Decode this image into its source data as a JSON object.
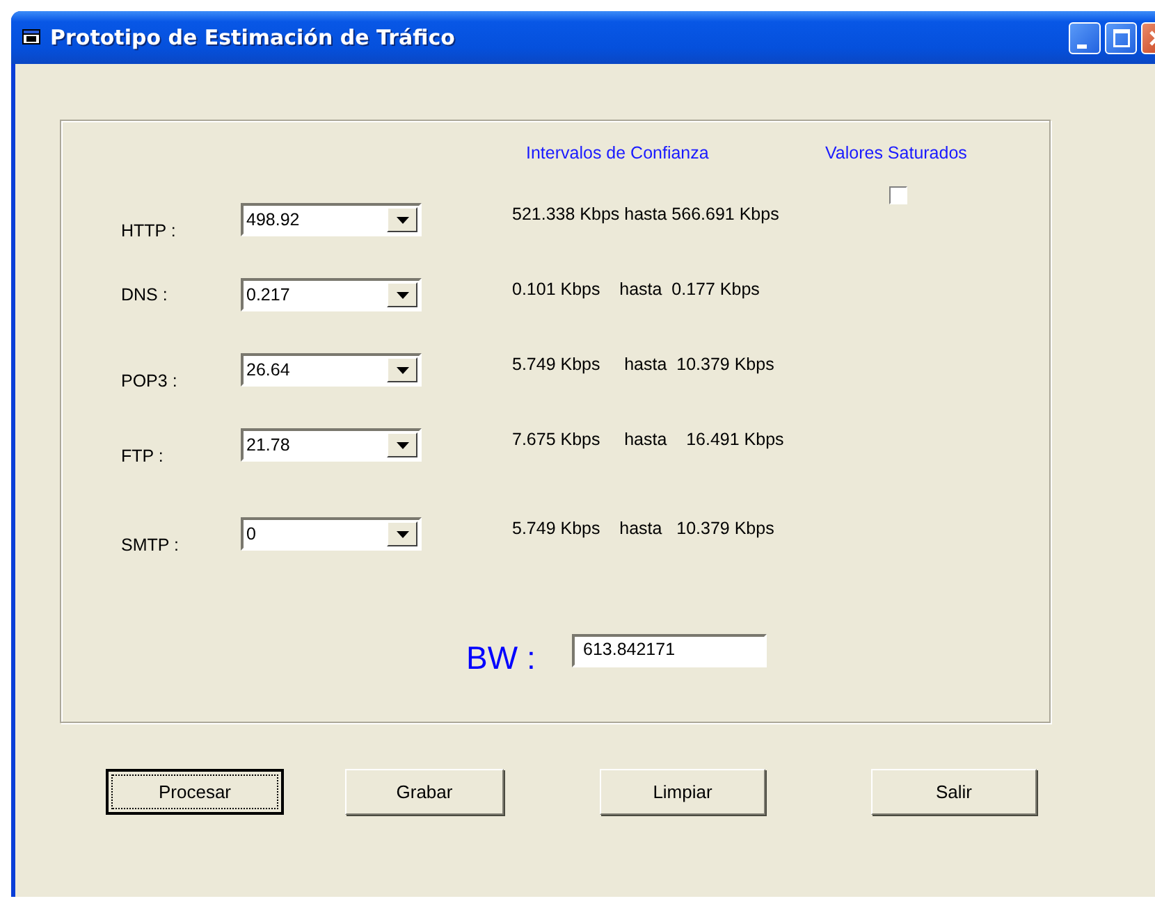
{
  "window": {
    "title": "Prototipo de Estimación de Tráfico"
  },
  "headers": {
    "intervals": "Intervalos de Confianza",
    "saturated": "Valores Saturados"
  },
  "saturated": {
    "checked": false
  },
  "rows": [
    {
      "label": "HTTP :",
      "value": "498.92",
      "interval": "521.338 Kbps hasta 566.691 Kbps"
    },
    {
      "label": "DNS :",
      "value": "0.217",
      "interval": "0.101 Kbps    hasta  0.177 Kbps"
    },
    {
      "label": "POP3 :",
      "value": "26.64",
      "interval": "5.749 Kbps     hasta  10.379 Kbps"
    },
    {
      "label": "FTP :",
      "value": "21.78",
      "interval": "7.675 Kbps     hasta    16.491 Kbps"
    },
    {
      "label": "SMTP :",
      "value": "0",
      "interval": "5.749 Kbps    hasta   10.379 Kbps"
    }
  ],
  "bw": {
    "label": "BW :",
    "value": "613.842171"
  },
  "buttons": [
    {
      "label": "Procesar",
      "focused": true
    },
    {
      "label": "Grabar",
      "focused": false
    },
    {
      "label": "Limpiar",
      "focused": false
    },
    {
      "label": "Salir",
      "focused": false
    }
  ]
}
